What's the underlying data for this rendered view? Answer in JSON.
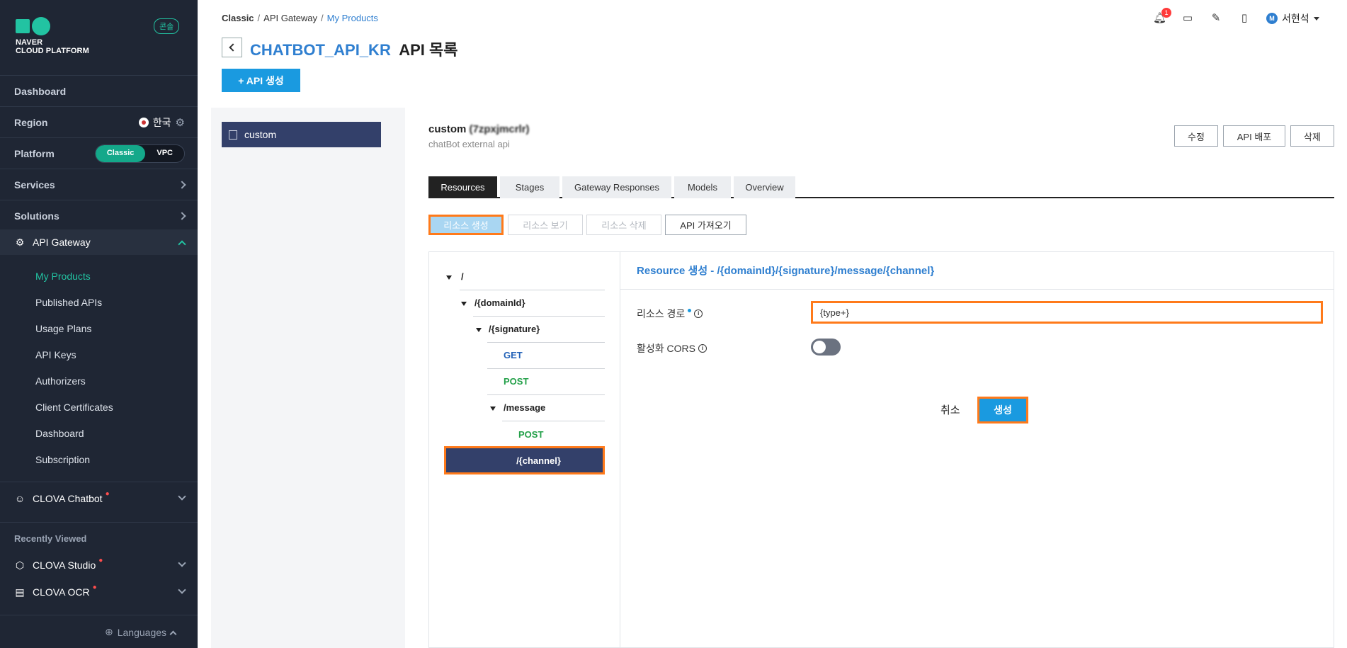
{
  "sidebar": {
    "logo_line1": "NAVER",
    "logo_line2": "CLOUD PLATFORM",
    "console_badge": "콘솔",
    "dashboard": "Dashboard",
    "region_label": "Region",
    "region_value": "한국",
    "platform_label": "Platform",
    "platform_classic": "Classic",
    "platform_vpc": "VPC",
    "services": "Services",
    "solutions": "Solutions",
    "api_gateway": "API Gateway",
    "sub_items": [
      "My Products",
      "Published APIs",
      "Usage Plans",
      "API Keys",
      "Authorizers",
      "Client Certificates",
      "Dashboard",
      "Subscription"
    ],
    "clova_chatbot": "CLOVA Chatbot",
    "recently_viewed": "Recently Viewed",
    "clova_studio": "CLOVA Studio",
    "clova_ocr": "CLOVA OCR",
    "languages": "Languages"
  },
  "header": {
    "breadcrumb": [
      "Classic",
      "API Gateway",
      "My Products"
    ],
    "product_name": "CHATBOT_API_KR",
    "title_suffix": "API 목록",
    "create_api_button": "+ API 생성",
    "notification_count": "1",
    "user_initial": "M",
    "user_name": "서현석"
  },
  "api_list": {
    "items": [
      "custom"
    ]
  },
  "api_detail": {
    "name": "custom",
    "id_blurred": "(7zpxjmcrlr)",
    "description": "chatBot external api",
    "edit_button": "수정",
    "deploy_button": "API 배포",
    "delete_button": "삭제"
  },
  "tabs": [
    "Resources",
    "Stages",
    "Gateway Responses",
    "Models",
    "Overview"
  ],
  "resource_buttons": {
    "create": "리소스 생성",
    "view": "리소스 보기",
    "delete": "리소스 삭제",
    "import": "API 가져오기"
  },
  "tree": {
    "root": "/",
    "domain": "/{domainId}",
    "signature": "/{signature}",
    "get": "GET",
    "post1": "POST",
    "message": "/message",
    "post2": "POST",
    "channel": "/{channel}"
  },
  "form": {
    "title": "Resource 생성 - /{domainId}/{signature}/message/{channel}",
    "path_label": "리소스 경로",
    "path_value": "{type+}",
    "cors_label": "활성화 CORS",
    "cors_enabled": false,
    "cancel": "취소",
    "submit": "생성"
  },
  "colors": {
    "sidebar_bg": "#1f2634",
    "accent": "#22c3a2",
    "primary": "#1a9ae0",
    "link": "#2f7fd0",
    "highlight": "#ff7a1a",
    "selected": "#33406a"
  }
}
